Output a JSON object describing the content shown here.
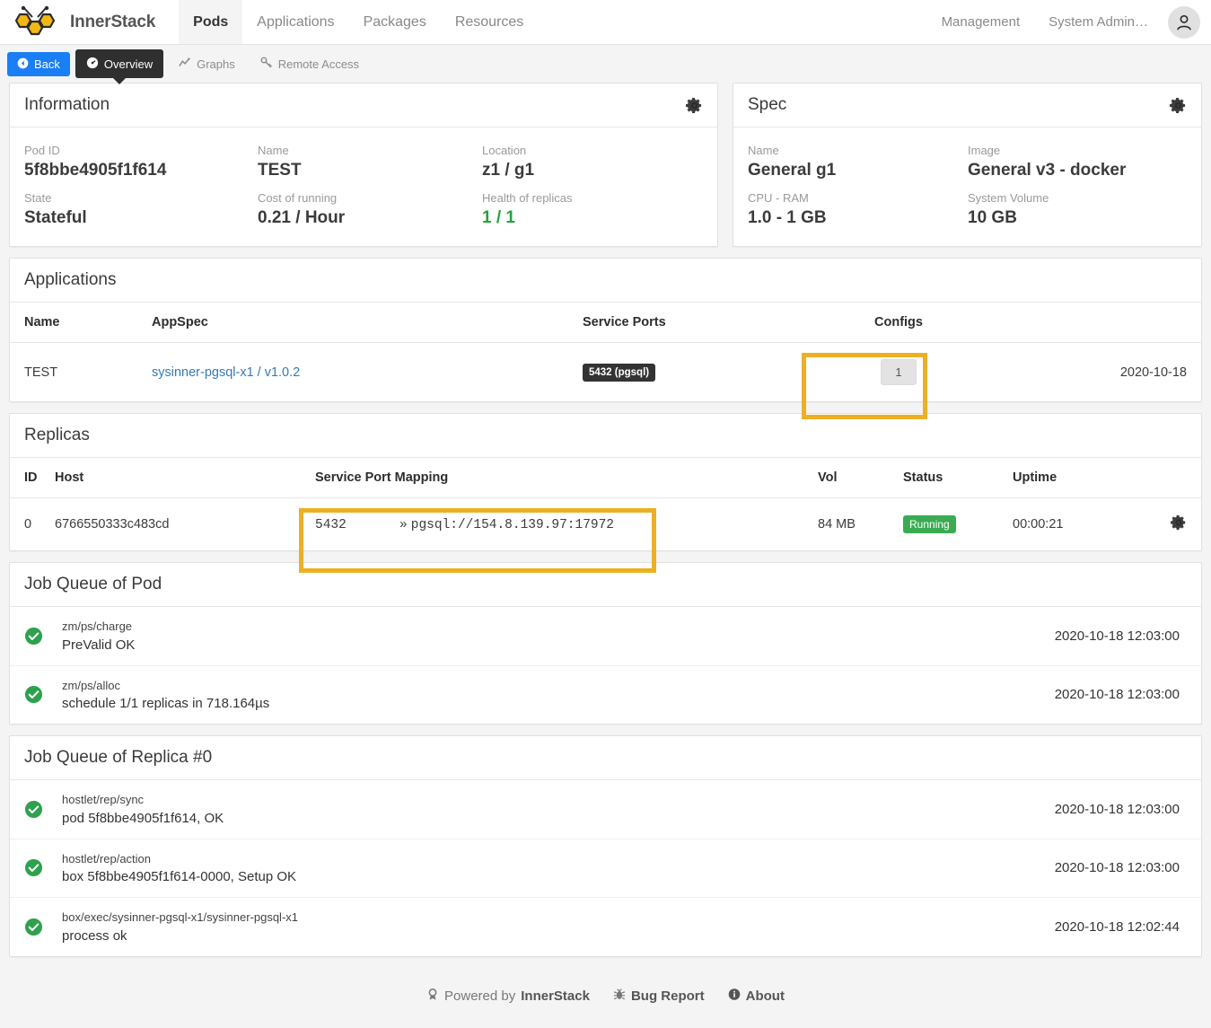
{
  "navbar": {
    "brand": "InnerStack",
    "logo_icon": "bee-hexagon-logo",
    "items": [
      {
        "label": "Pods",
        "active": true
      },
      {
        "label": "Applications",
        "active": false
      },
      {
        "label": "Packages",
        "active": false
      },
      {
        "label": "Resources",
        "active": false
      }
    ],
    "right_items": [
      {
        "label": "Management"
      },
      {
        "label": "System Admin…"
      }
    ],
    "avatar_icon": "user-avatar-icon"
  },
  "toolbar": {
    "back_label": "Back",
    "back_icon": "chevron-left-circle-icon",
    "overview_label": "Overview",
    "overview_icon": "dashboard-icon",
    "graphs_label": "Graphs",
    "graphs_icon": "chart-line-icon",
    "remote_access_label": "Remote Access",
    "remote_access_icon": "key-icon"
  },
  "information": {
    "title": "Information",
    "gear_icon": "gear-icon",
    "fields": [
      {
        "key": "Pod ID",
        "value": "5f8bbe4905f1f614"
      },
      {
        "key": "Name",
        "value": "TEST"
      },
      {
        "key": "Location",
        "value": "z1 / g1"
      },
      {
        "key": "State",
        "value": "Stateful"
      },
      {
        "key": "Cost of running",
        "value": "0.21 / Hour"
      },
      {
        "key": "Health of replicas",
        "value": "1 / 1"
      }
    ]
  },
  "spec": {
    "title": "Spec",
    "gear_icon": "gear-icon",
    "fields": [
      {
        "key": "Name",
        "value": "General g1"
      },
      {
        "key": "Image",
        "value": "General v3 - docker"
      },
      {
        "key": "CPU - RAM",
        "value": "1.0 - 1 GB"
      },
      {
        "key": "System Volume",
        "value": "10 GB"
      }
    ]
  },
  "applications": {
    "title": "Applications",
    "columns": [
      "Name",
      "AppSpec",
      "Service Ports",
      "Configs",
      ""
    ],
    "rows": [
      {
        "name": "TEST",
        "appspec": "sysinner-pgsql-x1 / v1.0.2",
        "service_port": "5432 (pgsql)",
        "configs": "1",
        "date": "2020-10-18"
      }
    ]
  },
  "replicas": {
    "title": "Replicas",
    "columns": [
      "ID",
      "Host",
      "Service Port Mapping",
      "Vol",
      "Status",
      "Uptime",
      ""
    ],
    "rows": [
      {
        "id": "0",
        "host": "6766550333c483cd",
        "port_src": "5432",
        "port_arrow": "»",
        "port_dst": "pgsql://154.8.139.97:17972",
        "vol": "84 MB",
        "status": "Running",
        "uptime": "00:00:21",
        "gear_icon": "gear-icon"
      }
    ]
  },
  "job_queue_pod": {
    "title": "Job Queue of Pod",
    "rows": [
      {
        "status_icon": "check-circle-icon",
        "name": "zm/ps/charge",
        "desc": "PreValid OK",
        "time": "2020-10-18 12:03:00"
      },
      {
        "status_icon": "check-circle-icon",
        "name": "zm/ps/alloc",
        "desc": "schedule 1/1 replicas in 718.164µs",
        "time": "2020-10-18 12:03:00"
      }
    ]
  },
  "job_queue_replica": {
    "title": "Job Queue of Replica #0",
    "rows": [
      {
        "status_icon": "check-circle-icon",
        "name": "hostlet/rep/sync",
        "desc": "pod 5f8bbe4905f1f614, OK",
        "time": "2020-10-18 12:03:00"
      },
      {
        "status_icon": "check-circle-icon",
        "name": "hostlet/rep/action",
        "desc": "box 5f8bbe4905f1f614-0000, Setup OK",
        "time": "2020-10-18 12:03:00"
      },
      {
        "status_icon": "check-circle-icon",
        "name": "box/exec/sysinner-pgsql-x1/sysinner-pgsql-x1",
        "desc": "process ok",
        "time": "2020-10-18 12:02:44"
      }
    ]
  },
  "footer": {
    "powered_prefix": "Powered by ",
    "powered_brand": "InnerStack",
    "powered_icon": "award-icon",
    "bug_report": "Bug Report",
    "bug_icon": "bug-icon",
    "about": "About",
    "about_icon": "info-circle-icon"
  },
  "colors": {
    "accent_blue": "#1a7ef4",
    "link_blue": "#337ab7",
    "highlight_yellow": "#edb024",
    "success_green": "#3aab52",
    "health_green": "#22a33e",
    "logo_yellow": "#f2b712",
    "dark": "#2f2f2f"
  }
}
